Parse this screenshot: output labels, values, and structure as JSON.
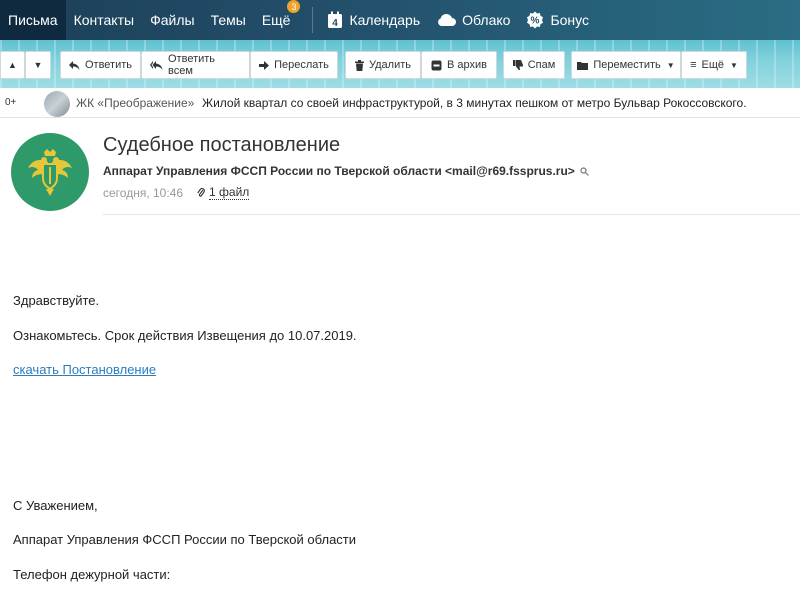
{
  "nav": {
    "items": [
      {
        "label": "Письма",
        "active": true
      },
      {
        "label": "Контакты"
      },
      {
        "label": "Файлы"
      },
      {
        "label": "Темы"
      },
      {
        "label": "Ещё",
        "badge": "3"
      }
    ],
    "services": [
      {
        "label": "Календарь",
        "icon": "calendar-icon",
        "icon_text": "4"
      },
      {
        "label": "Облако",
        "icon": "cloud-icon"
      },
      {
        "label": "Бонус",
        "icon": "bonus-icon"
      }
    ]
  },
  "toolbar": {
    "reply": "Ответить",
    "reply_all": "Ответить всем",
    "forward": "Переслать",
    "delete": "Удалить",
    "archive": "В архив",
    "spam": "Спам",
    "move": "Переместить",
    "more": "Ещё"
  },
  "ad": {
    "age": "0+",
    "name": "ЖК «Преображение»",
    "text": "Жилой квартал со своей инфраструктурой, в 3 минутах пешком от метро Бульвар Рокоссовского."
  },
  "message": {
    "subject": "Судебное постановление",
    "sender": "Аппарат Управления ФССП России по Тверской области <mail@r69.fssprus.ru>",
    "date": "сегодня, 10:46",
    "attachments": "1 файл",
    "greeting": "Здравствуйте.",
    "line1": "Ознакомьтесь. Срок действия Извещения до 10.07.2019.",
    "link": "скачать Постановление",
    "regards": "С Уважением,",
    "org": "Аппарат Управления ФССП России по Тверской области",
    "phone": "Телефон дежурной части:"
  },
  "colors": {
    "nav_bg": "#23506c",
    "badge": "#f0a32a",
    "logo_bg": "#2f9a69",
    "link": "#2a7dbf"
  }
}
